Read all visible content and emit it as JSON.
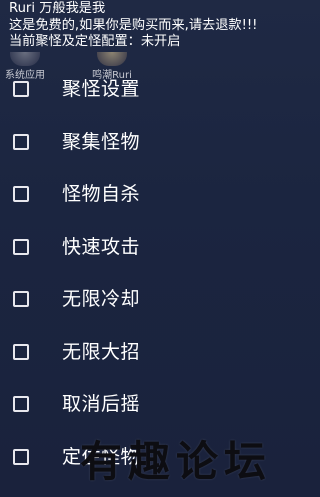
{
  "header": {
    "line1": "Ruri 万般我是我",
    "line2": "这是免费的,如果你是购买而来,请去退款!!!",
    "line3": "当前聚怪及定怪配置：未开启"
  },
  "background_apps": [
    {
      "label": "系统应用"
    },
    {
      "label": "鸣潮Ruri"
    }
  ],
  "menu": {
    "items": [
      {
        "label": "聚怪设置",
        "checked": false
      },
      {
        "label": "聚集怪物",
        "checked": false
      },
      {
        "label": "怪物自杀",
        "checked": false
      },
      {
        "label": "快速攻击",
        "checked": false
      },
      {
        "label": "无限冷却",
        "checked": false
      },
      {
        "label": "无限大招",
        "checked": false
      },
      {
        "label": "取消后摇",
        "checked": false
      },
      {
        "label": "定住怪物",
        "checked": false
      }
    ]
  },
  "watermark": {
    "text": "有趣论坛"
  },
  "colors": {
    "background": "#1c2540",
    "text": "#ffffff",
    "checkbox_border": "#e8e8ee"
  }
}
